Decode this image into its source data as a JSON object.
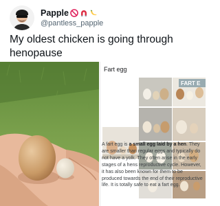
{
  "tweet": {
    "display_name": "Papple",
    "name_emojis": [
      "no-entry-icon",
      "magnet-icon",
      "banana-icon"
    ],
    "handle": "@pantless_papple",
    "text": "My oldest chicken is going through henopause"
  },
  "card": {
    "title": "Fart egg",
    "thumb_overlay": "FART E",
    "thumb_caption": "",
    "desc_prefix": "A fart egg is ",
    "desc_bold": "a small egg laid by a hen",
    "desc_rest": ". They are smaller than regular eggs and typically do not have a yolk. They often arise in the early stages of a hens reproductive cycle. However, it has also been known for them to be produced towards the end of their reproductive life. It is totally safe to eat a fart egg."
  },
  "colors": {
    "accent_red": "#e0245e",
    "text_primary": "#0f1419",
    "text_secondary": "#536471"
  }
}
